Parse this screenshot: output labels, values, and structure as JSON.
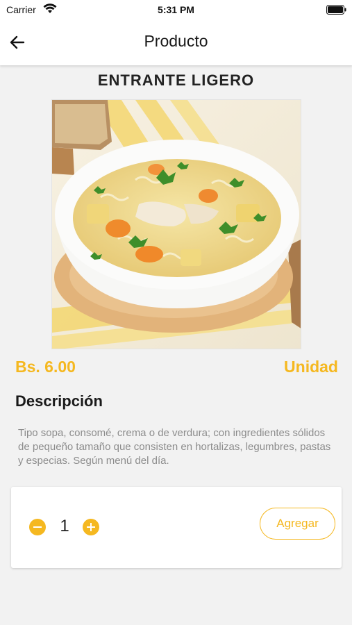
{
  "status_bar": {
    "carrier": "Carrier",
    "time": "5:31 PM"
  },
  "nav": {
    "title": "Producto",
    "back_icon": "arrow-left-icon"
  },
  "product": {
    "name": "ENTRANTE LIGERO",
    "image": "chicken-noodle-soup-photo",
    "price": "Bs. 6.00",
    "unit": "Unidad",
    "description_heading": "Descripción",
    "description": "Tipo sopa, consomé, crema o de verdura; con ingredientes sólidos de pequeño tamaño que consisten en hortalizas, legumbres, pastas y especias. Según menú del día."
  },
  "cart": {
    "quantity": "1",
    "add_label": "Agregar",
    "decrement_icon": "minus-circle-icon",
    "increment_icon": "plus-circle-icon"
  },
  "colors": {
    "accent": "#f5b820",
    "background": "#f2f2f2",
    "description_text": "#8c8c8c"
  }
}
